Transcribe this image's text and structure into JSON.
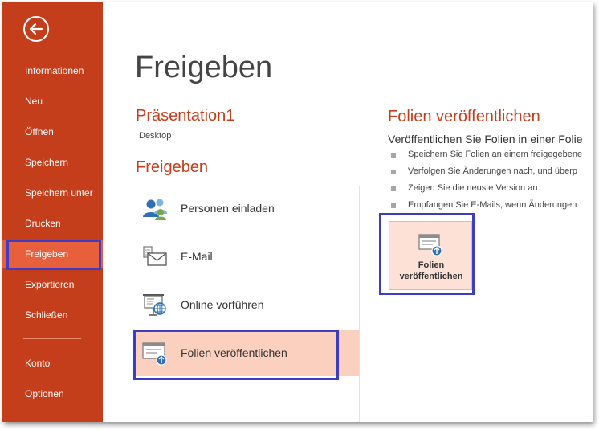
{
  "sidebar": {
    "items": [
      {
        "label": "Informationen"
      },
      {
        "label": "Neu"
      },
      {
        "label": "Öffnen"
      },
      {
        "label": "Speichern"
      },
      {
        "label": "Speichern unter"
      },
      {
        "label": "Drucken"
      },
      {
        "label": "Freigeben",
        "active": true
      },
      {
        "label": "Exportieren"
      },
      {
        "label": "Schließen"
      },
      {
        "label": "Konto"
      },
      {
        "label": "Optionen"
      }
    ],
    "back_icon": "back-arrow-icon"
  },
  "main": {
    "title": "Freigeben",
    "presentation_name": "Präsentation1",
    "presentation_location": "Desktop",
    "section_title": "Freigeben",
    "share_options": [
      {
        "label": "Personen einladen",
        "icon": "people-icon"
      },
      {
        "label": "E-Mail",
        "icon": "email-icon"
      },
      {
        "label": "Online vorführen",
        "icon": "present-online-icon"
      },
      {
        "label": "Folien veröffentlichen",
        "icon": "publish-slides-icon",
        "active": true
      }
    ]
  },
  "detail": {
    "title": "Folien veröffentlichen",
    "subtitle": "Veröffentlichen Sie Folien in einer Folie",
    "bullets": [
      "Speichern Sie Folien an einem freigegebene",
      "Verfolgen Sie Änderungen nach, und überp",
      "Zeigen Sie die neuste Version an.",
      "Empfangen Sie E-Mails, wenn Änderungen"
    ],
    "button_line1": "Folien",
    "button_line2": "veröffentlichen"
  },
  "colors": {
    "accent": "#c43e1c",
    "active_sidebar": "#e8603b",
    "active_option": "#fbd0bf",
    "highlight": "#3c3dc4"
  }
}
